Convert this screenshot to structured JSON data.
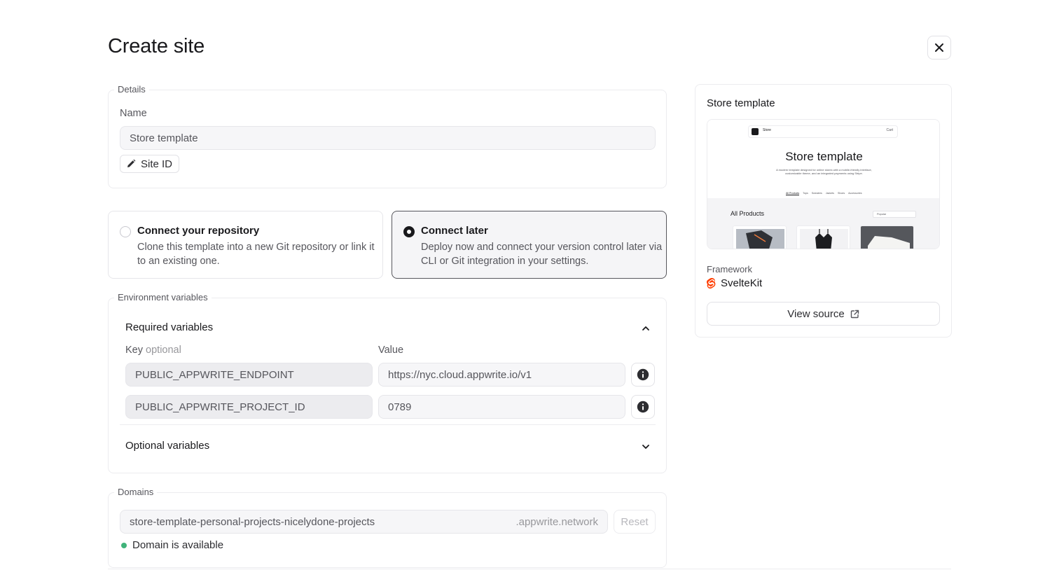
{
  "dialog": {
    "title": "Create site"
  },
  "details": {
    "legend": "Details",
    "name_label": "Name",
    "name_value": "Store template",
    "site_id_label": "Site ID"
  },
  "repo_options": [
    {
      "title": "Connect your repository",
      "description": "Clone this template into a new Git repository or link it to an existing one.",
      "selected": false
    },
    {
      "title": "Connect later",
      "description": "Deploy now and connect your version control later via CLI or Git integration in your settings.",
      "selected": true
    }
  ],
  "env": {
    "legend": "Environment variables",
    "required_title": "Required variables",
    "key_label": "Key",
    "key_optional": "optional",
    "value_label": "Value",
    "rows": [
      {
        "key": "PUBLIC_APPWRITE_ENDPOINT",
        "value": "https://nyc.cloud.appwrite.io/v1"
      },
      {
        "key": "PUBLIC_APPWRITE_PROJECT_ID",
        "value": "0789"
      }
    ],
    "optional_title": "Optional variables"
  },
  "domains": {
    "legend": "Domains",
    "subdomain": "store-template-personal-projects-nicelydone-projects",
    "suffix": ".appwrite.network",
    "reset_label": "Reset",
    "status": "Domain is available",
    "status_color": "#40b37a"
  },
  "template_card": {
    "title": "Store template",
    "preview": {
      "brand": "Store",
      "cart": "Cart",
      "heading": "Store template",
      "subtitle": "A modern template designed for online stores with a mobile-friendly interface, customizable theme, and an integrated payments using Stripe.",
      "tabs": [
        "All Products",
        "Tops",
        "Sweaters",
        "Jackets",
        "Shoes",
        "Accessories"
      ],
      "section": "All Products",
      "sort": "Popular"
    },
    "framework_label": "Framework",
    "framework": "SvelteKit",
    "framework_color": "#ff3e00",
    "view_source": "View source"
  },
  "colors": {
    "accent": "#19191c",
    "muted": "#56565c",
    "border": "#ececef"
  }
}
